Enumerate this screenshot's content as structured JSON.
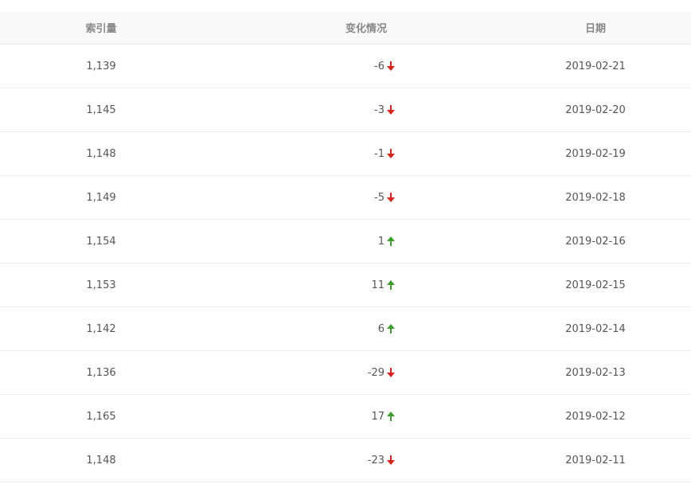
{
  "table": {
    "headers": {
      "index_count": "索引量",
      "change": "变化情况",
      "date": "日期"
    },
    "rows": [
      {
        "index_count": "1,139",
        "change": "-6",
        "direction": "down",
        "date": "2019-02-21"
      },
      {
        "index_count": "1,145",
        "change": "-3",
        "direction": "down",
        "date": "2019-02-20"
      },
      {
        "index_count": "1,148",
        "change": "-1",
        "direction": "down",
        "date": "2019-02-19"
      },
      {
        "index_count": "1,149",
        "change": "-5",
        "direction": "down",
        "date": "2019-02-18"
      },
      {
        "index_count": "1,154",
        "change": "1",
        "direction": "up",
        "date": "2019-02-16"
      },
      {
        "index_count": "1,153",
        "change": "11",
        "direction": "up",
        "date": "2019-02-15"
      },
      {
        "index_count": "1,142",
        "change": "6",
        "direction": "up",
        "date": "2019-02-14"
      },
      {
        "index_count": "1,136",
        "change": "-29",
        "direction": "down",
        "date": "2019-02-13"
      },
      {
        "index_count": "1,165",
        "change": "17",
        "direction": "up",
        "date": "2019-02-12"
      },
      {
        "index_count": "1,148",
        "change": "-23",
        "direction": "down",
        "date": "2019-02-11"
      }
    ]
  },
  "colors": {
    "down_arrow": "#e0201b",
    "up_arrow": "#3d9e2c",
    "header_bg": "#f9f9f9",
    "row_border": "#ececec"
  },
  "icons": {
    "down": "arrow-down-icon",
    "up": "arrow-up-icon"
  }
}
